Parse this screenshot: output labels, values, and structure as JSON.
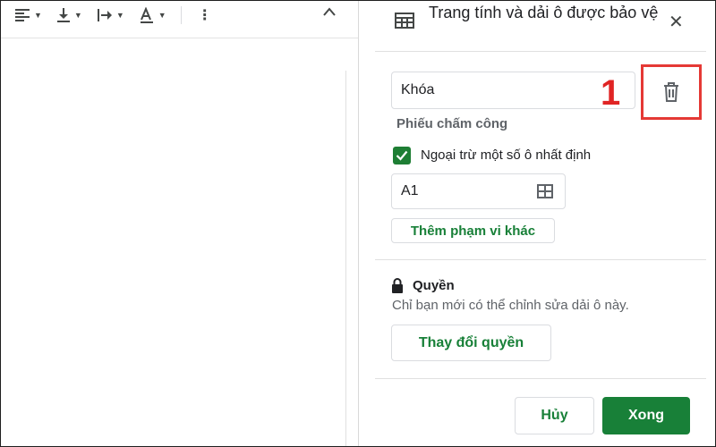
{
  "toolbar": {
    "tools": [
      {
        "icon": "align-left-icon"
      },
      {
        "icon": "vertical-align-bottom-icon"
      },
      {
        "icon": "text-wrap-icon"
      },
      {
        "icon": "text-rotation-icon"
      }
    ],
    "more_icon": "more-vert-icon",
    "collapse_icon": "chevron-up-icon"
  },
  "panel": {
    "title": "Trang tính và dải ô được bảo vệ",
    "description_value": "Khóa",
    "sheet_name": "Phiếu chấm công",
    "except_label": "Ngoại trừ một số ô nhất định",
    "except_checked": true,
    "range_value": "A1",
    "add_range_label": "Thêm phạm vi khác",
    "permissions_title": "Quyền",
    "permissions_desc": "Chỉ bạn mới có thể chỉnh sửa dải ô này.",
    "change_permissions_label": "Thay đổi quyền",
    "cancel_label": "Hủy",
    "done_label": "Xong"
  },
  "annotation": {
    "step_number": "1",
    "color": "#e53935"
  },
  "colors": {
    "accent_green": "#188038",
    "annotation_red": "#e53935"
  }
}
